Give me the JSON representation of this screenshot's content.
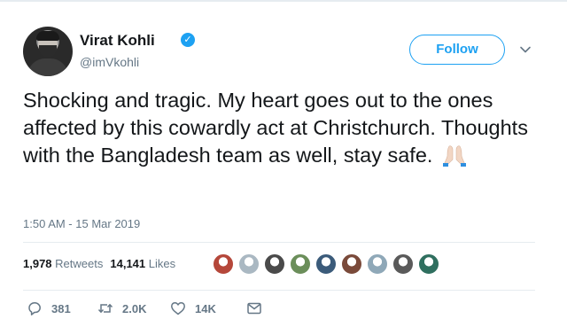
{
  "user": {
    "name": "Virat Kohli",
    "handle": "@imVkohli",
    "verified_mark": "✓"
  },
  "follow_label": "Follow",
  "tweet": {
    "text": "Shocking and tragic. My heart goes out to the ones affected by this cowardly act at Christchurch. Thoughts with the Bangladesh team as well, stay safe.",
    "emoji": "folded-hands-emoji",
    "timestamp": "1:50 AM - 15 Mar 2019"
  },
  "stats": {
    "retweets_count": "1,978",
    "retweets_label": "Retweets",
    "likes_count": "14,141",
    "likes_label": "Likes"
  },
  "likers": [
    {
      "icon": "liker-avatar",
      "color": "#b5473a"
    },
    {
      "icon": "default-avatar",
      "color": "#aab8c2"
    },
    {
      "icon": "liker-avatar",
      "color": "#4a4a4a"
    },
    {
      "icon": "liker-avatar",
      "color": "#6b8e5a"
    },
    {
      "icon": "liker-avatar",
      "color": "#3b5b7a"
    },
    {
      "icon": "liker-avatar",
      "color": "#7a4a3a"
    },
    {
      "icon": "liker-avatar",
      "color": "#8fa8b8"
    },
    {
      "icon": "liker-avatar",
      "color": "#5a5a5a"
    },
    {
      "icon": "liker-avatar",
      "color": "#2f6f5f"
    }
  ],
  "actions": {
    "replies": "381",
    "retweets": "2.0K",
    "likes": "14K"
  },
  "colors": {
    "accent": "#1da1f2",
    "text": "#14171a",
    "muted": "#657786",
    "divider": "#e6ecf0"
  }
}
